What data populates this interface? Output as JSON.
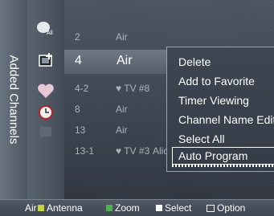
{
  "sidebar": {
    "title": "Added Channels"
  },
  "channels": [
    {
      "number": "2",
      "type": "Air",
      "name": ""
    },
    {
      "number": "4",
      "type": "Air",
      "name": ""
    },
    {
      "number": "4-2",
      "type": "♥ TV #8",
      "name": ""
    },
    {
      "number": "8",
      "type": "Air",
      "name": ""
    },
    {
      "number": "13",
      "type": "Air",
      "name": ""
    },
    {
      "number": "13-1",
      "type": "♥ TV #3",
      "name": "Alice"
    }
  ],
  "selected_index": 1,
  "context_menu": {
    "items": [
      "Delete",
      "Add to Favorite",
      "Timer Viewing",
      "Channel Name Edit",
      "Select All",
      "Auto Program"
    ],
    "active_index": 5
  },
  "bottom_bar": {
    "air": "Air",
    "antenna": "Antenna",
    "zoom": "Zoom",
    "select": "Select",
    "option": "Option"
  },
  "colors": {
    "antenna_key": "#c7d23a",
    "zoom_key": "#4bb24f",
    "select_key": "#ffffff"
  }
}
